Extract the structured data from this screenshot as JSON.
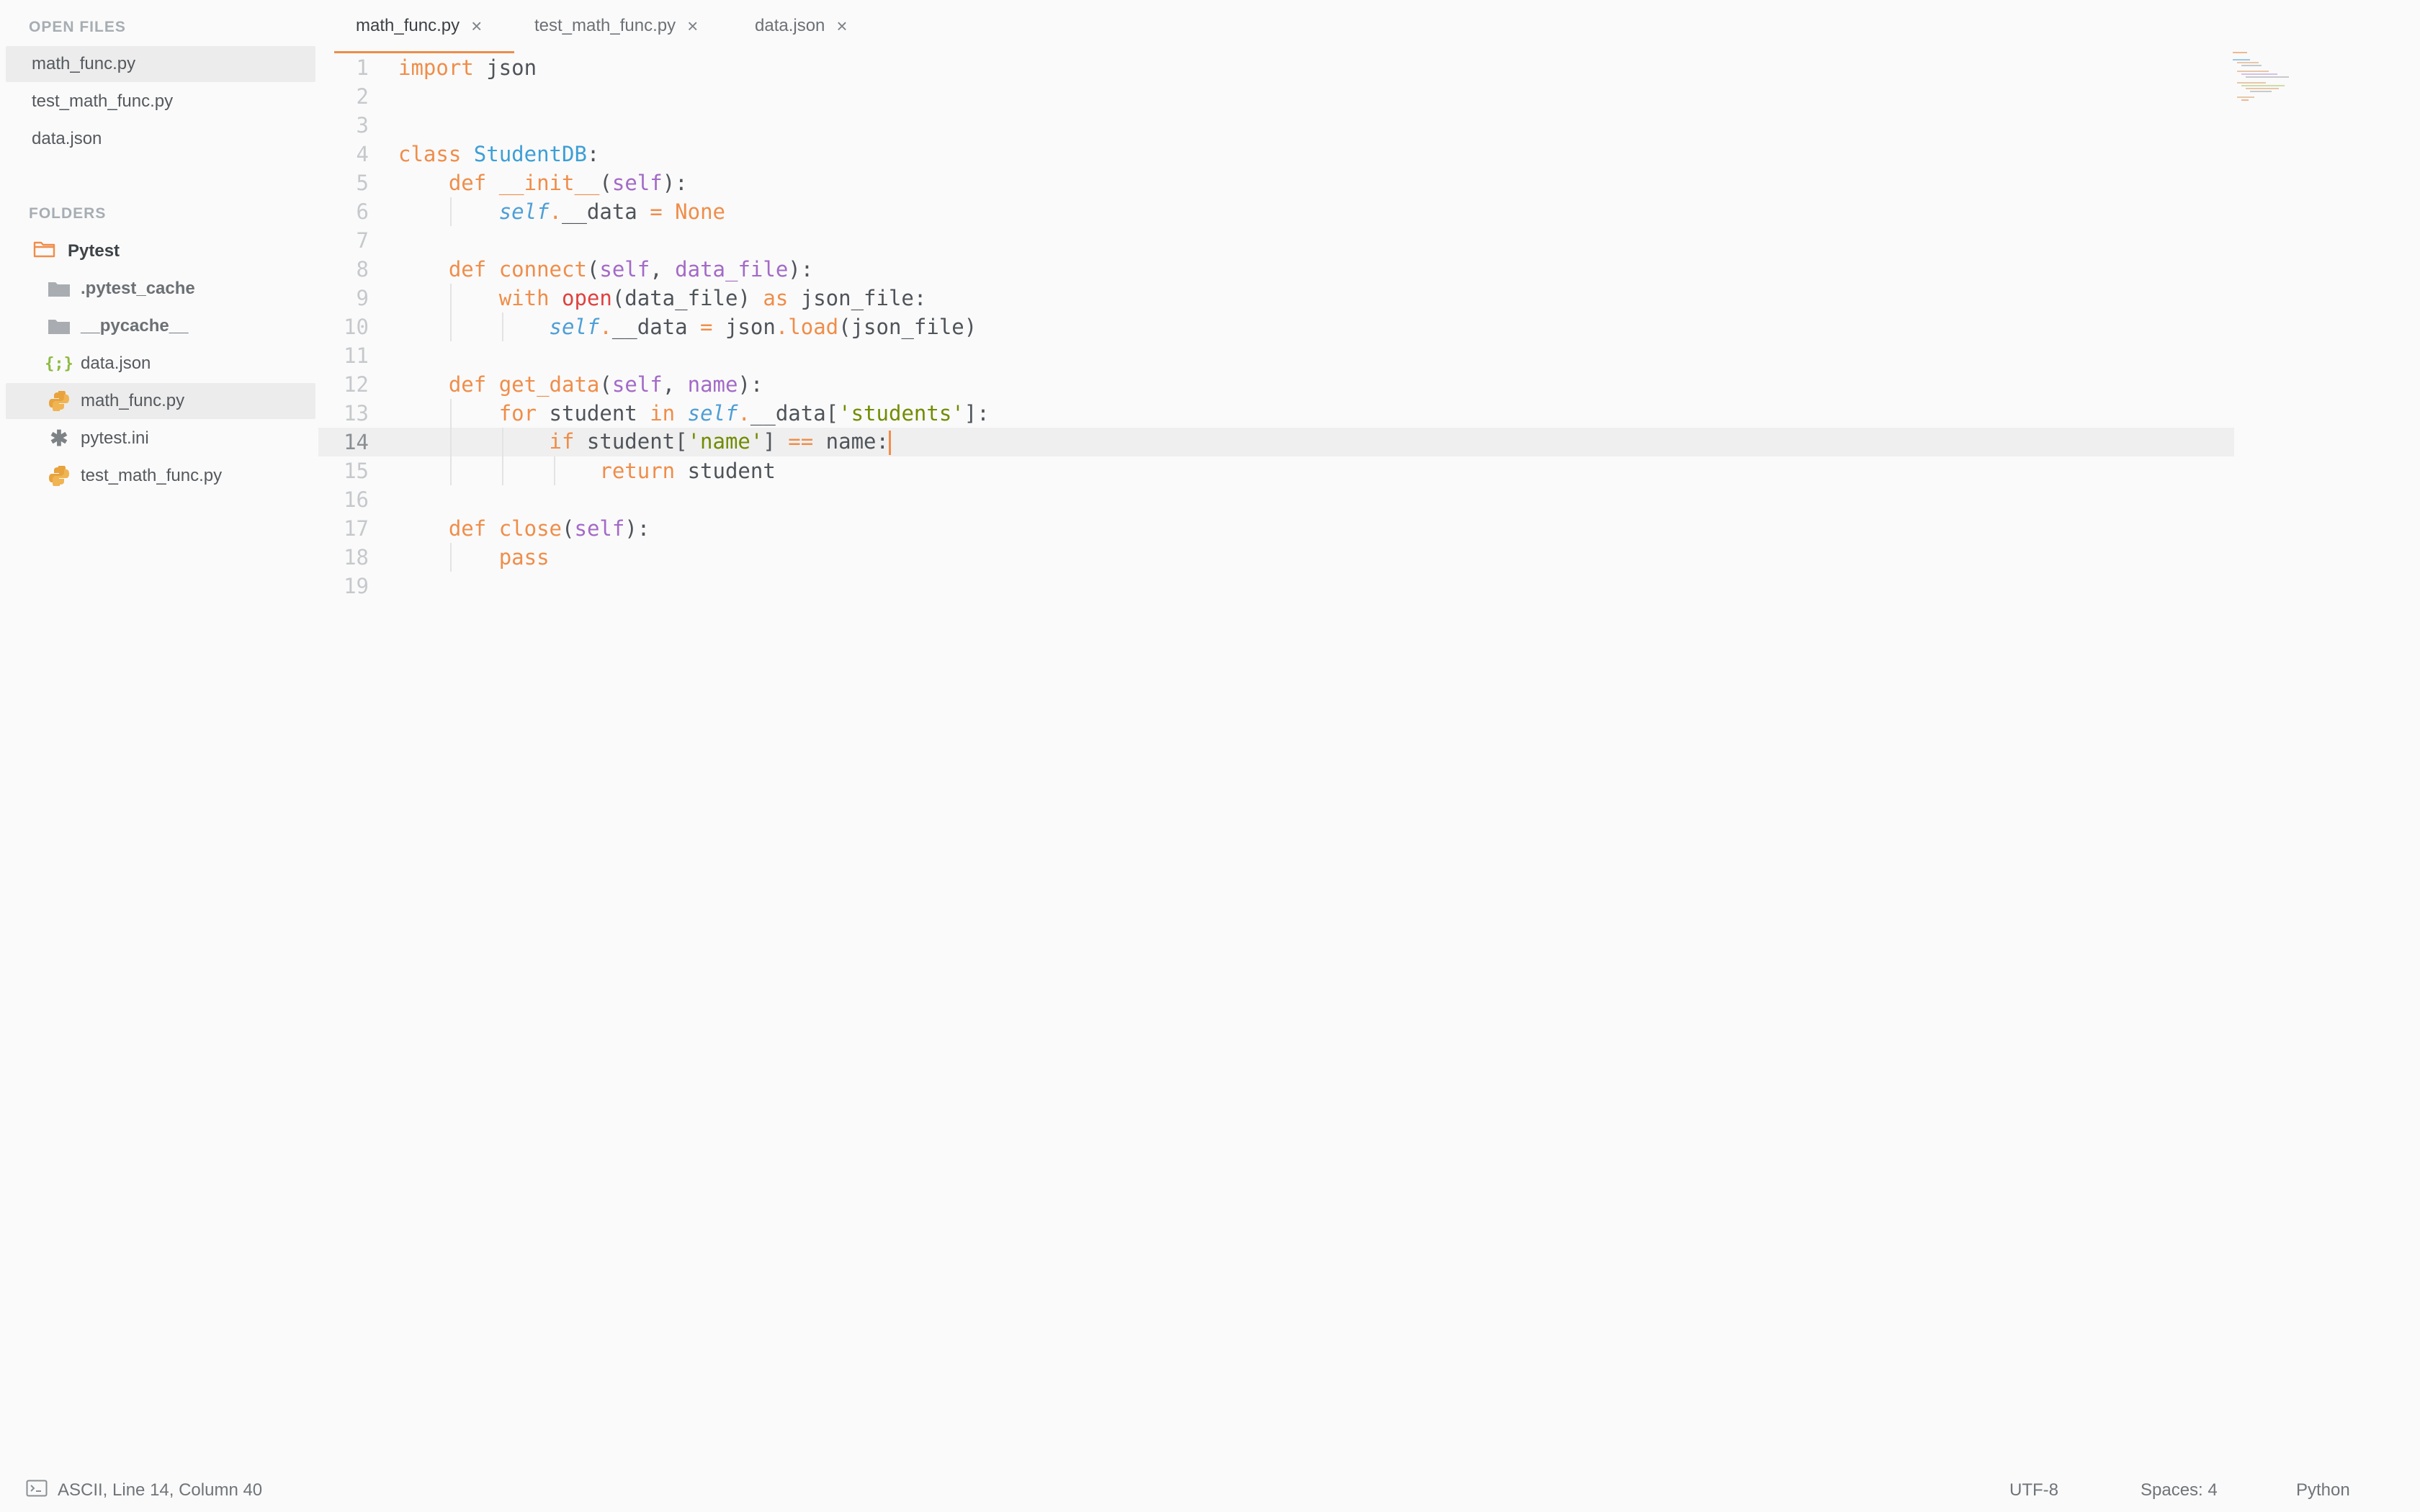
{
  "sidebar": {
    "open_files_title": "OPEN FILES",
    "open_files": [
      {
        "label": "math_func.py",
        "selected": true
      },
      {
        "label": "test_math_func.py"
      },
      {
        "label": "data.json"
      }
    ],
    "folders_title": "FOLDERS",
    "root_folder": {
      "label": "Pytest",
      "icon": "folder-open-icon"
    },
    "tree": [
      {
        "label": ".pytest_cache",
        "icon": "folder-icon",
        "type": "dir"
      },
      {
        "label": "__pycache__",
        "icon": "folder-icon",
        "type": "dir"
      },
      {
        "label": "data.json",
        "icon": "json-file-icon"
      },
      {
        "label": "math_func.py",
        "icon": "python-file-icon",
        "selected": true
      },
      {
        "label": "pytest.ini",
        "icon": "settings-file-icon"
      },
      {
        "label": "test_math_func.py",
        "icon": "python-file-icon"
      }
    ]
  },
  "tabs": [
    {
      "label": "math_func.py",
      "active": true
    },
    {
      "label": "test_math_func.py"
    },
    {
      "label": "data.json"
    }
  ],
  "tab_close_glyph": "×",
  "editor": {
    "current_line": 14,
    "line_numbers": [
      "1",
      "2",
      "3",
      "4",
      "5",
      "6",
      "7",
      "8",
      "9",
      "10",
      "11",
      "12",
      "13",
      "14",
      "15",
      "16",
      "17",
      "18",
      "19"
    ],
    "lines": [
      "import json",
      "",
      "",
      "class StudentDB:",
      "    def __init__(self):",
      "        self.__data = None",
      "",
      "    def connect(self, data_file):",
      "        with open(data_file) as json_file:",
      "            self.__data = json.load(json_file)",
      "",
      "    def get_data(self, name):",
      "        for student in self.__data['students']:",
      "            if student['name'] == name:",
      "                return student",
      "",
      "    def close(self):",
      "        pass",
      ""
    ]
  },
  "statusbar": {
    "position": "ASCII, Line 14, Column 40",
    "encoding": "UTF-8",
    "indentation": "Spaces: 4",
    "syntax": "Python"
  },
  "colors": {
    "accent": "#f08d49",
    "keyword": "#f08d49",
    "class_name": "#3d9fd6",
    "parameter": "#a36ac7",
    "string": "#718c00",
    "background": "#fafafa"
  }
}
